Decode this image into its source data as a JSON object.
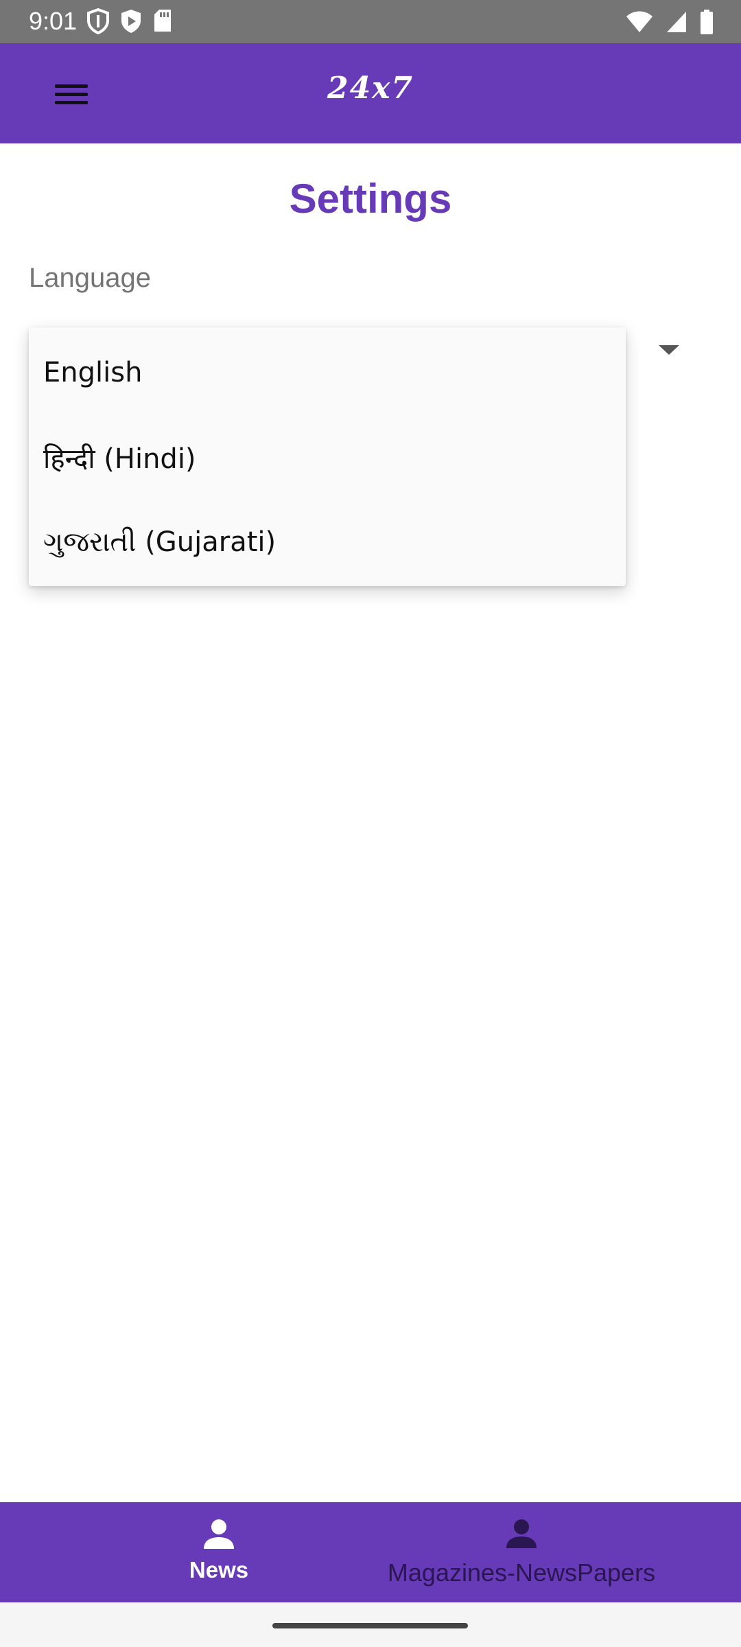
{
  "status_bar": {
    "time": "9:01",
    "icons": [
      "shield-icon",
      "play-protect-icon",
      "sd-card-icon",
      "wifi-icon",
      "signal-icon",
      "battery-icon"
    ]
  },
  "app_bar": {
    "title": "24x7",
    "menu_icon": "hamburger-menu-icon",
    "background_color": "#673ab7"
  },
  "settings": {
    "title": "Settings",
    "language_label": "Language",
    "language_options": [
      "English",
      "हिन्दी (Hindi)",
      "ગુજરાતી (Gujarati)"
    ]
  },
  "bottom_nav": {
    "items": [
      {
        "label": "News",
        "icon": "person-icon",
        "active": true
      },
      {
        "label": "Magazines-NewsPapers",
        "icon": "person-icon",
        "active": false
      }
    ]
  },
  "colors": {
    "accent": "#673ab7",
    "label_gray": "#757575"
  }
}
